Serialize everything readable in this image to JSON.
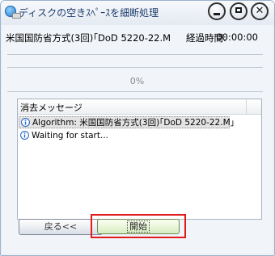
{
  "window": {
    "title": "ディスクの空きｽﾍﾟｰｽを細断処理",
    "controls": {
      "minimize": "minimize",
      "maximize": "maximize",
      "close": "close"
    }
  },
  "status": {
    "method": "米国国防省方式(3回)｢DoD 5220-22.M",
    "elapsed_label": "経過時間:",
    "elapsed_value": "00:00:00"
  },
  "progress": {
    "percent_text": "0%",
    "value": 0
  },
  "messages": {
    "header": "消去メッセージ",
    "rows": [
      {
        "icon": "info-icon",
        "text": "Algorithm: 米国国防省方式(3回)｢DoD 5220-22.M｣"
      },
      {
        "icon": "info-icon",
        "text": "Waiting for start..."
      }
    ]
  },
  "buttons": {
    "back": "戻る<<",
    "start": "開始"
  },
  "colors": {
    "highlight_border": "#e01b1b",
    "start_button": "#d7ecc0",
    "selected_row": "#e4e4e4"
  }
}
